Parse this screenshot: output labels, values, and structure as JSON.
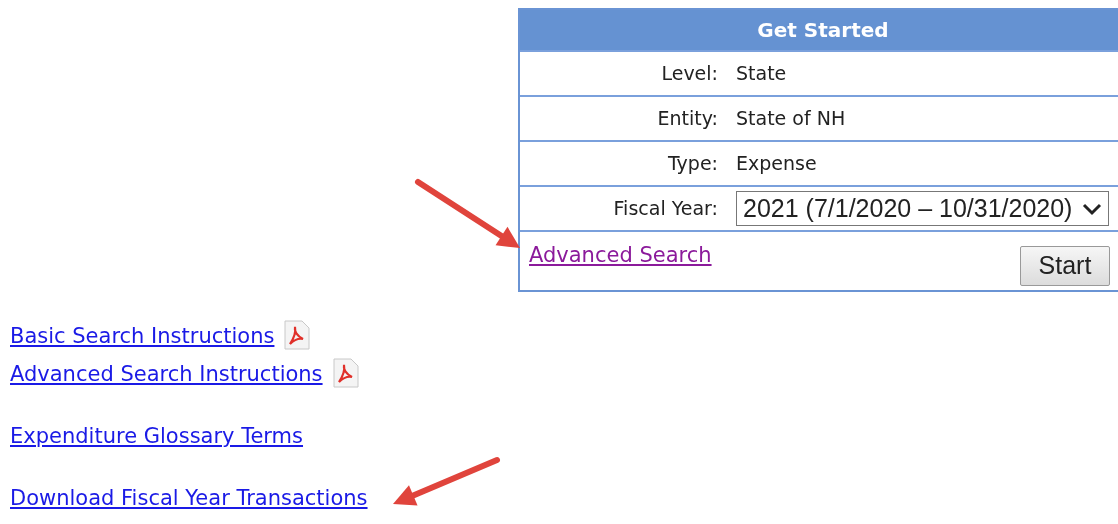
{
  "panel": {
    "title": "Get Started",
    "fields": [
      {
        "kind": "text",
        "label": "Level:",
        "value": "State"
      },
      {
        "kind": "text",
        "label": "Entity:",
        "value": "State of NH"
      },
      {
        "kind": "text",
        "label": "Type:",
        "value": "Expense"
      },
      {
        "kind": "select",
        "label": "Fiscal Year:",
        "value": "2021 (7/1/2020 – 10/31/2020)"
      }
    ],
    "link": {
      "label": "Advanced Search",
      "visited": true
    },
    "button": "Start"
  },
  "link_groups": [
    {
      "links": [
        {
          "kind": "pdf",
          "label": "Basic Search Instructions",
          "visited": false
        },
        {
          "kind": "pdf",
          "label": "Advanced Search Instructions",
          "visited": false
        }
      ]
    },
    {
      "links": [
        {
          "kind": "plain",
          "label": "Expenditure Glossary Terms",
          "visited": false
        }
      ]
    },
    {
      "links": [
        {
          "kind": "plain",
          "label": "Download Fiscal Year Transactions",
          "visited": false
        }
      ]
    }
  ]
}
